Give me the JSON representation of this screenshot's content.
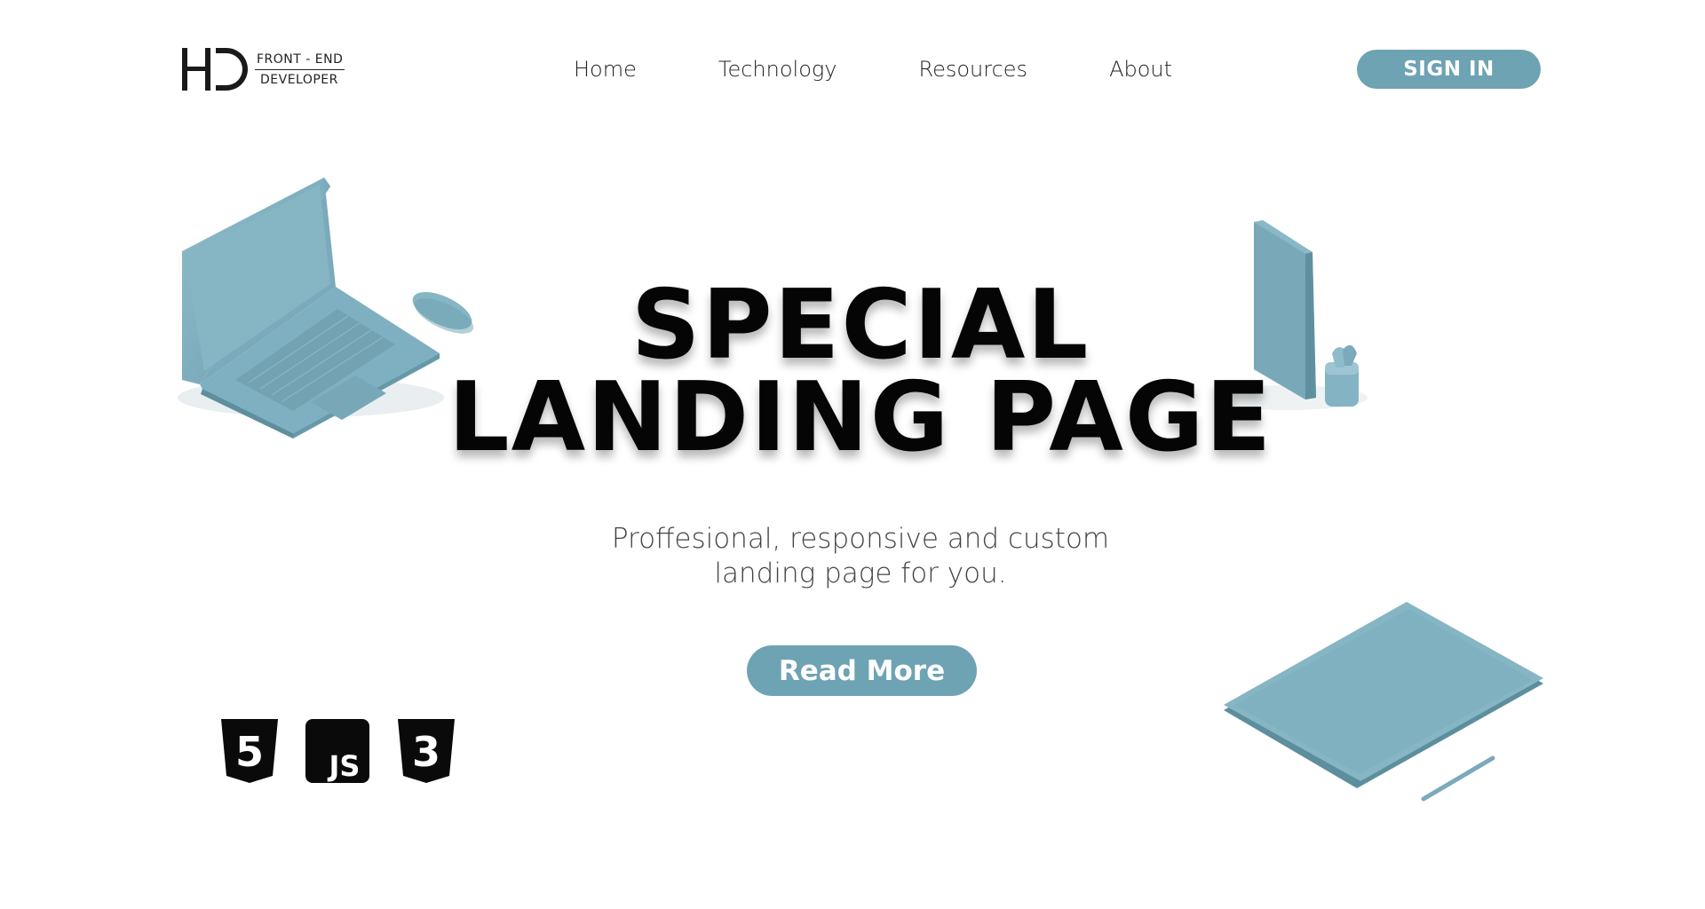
{
  "header": {
    "logo": {
      "monogram": "HD",
      "line1": "FRONT - END",
      "line2": "DEVELOPER"
    },
    "nav": [
      {
        "label": "Home"
      },
      {
        "label": "Technology"
      },
      {
        "label": "Resources"
      },
      {
        "label": "About"
      }
    ],
    "signin_label": "SIGN IN"
  },
  "hero": {
    "title_line1": "SPECIAL",
    "title_line2": "LANDING PAGE",
    "subtitle_line1": "Proffesional, responsive and custom",
    "subtitle_line2": "landing page for you.",
    "cta_label": "Read More"
  },
  "tech_icons": [
    {
      "name": "html5-icon",
      "text": "5"
    },
    {
      "name": "javascript-icon",
      "text": "JS"
    },
    {
      "name": "css3-icon",
      "text": "3"
    }
  ],
  "colors": {
    "accent": "#6ea3b4",
    "device": "#7fb0c1",
    "text": "#050505"
  }
}
